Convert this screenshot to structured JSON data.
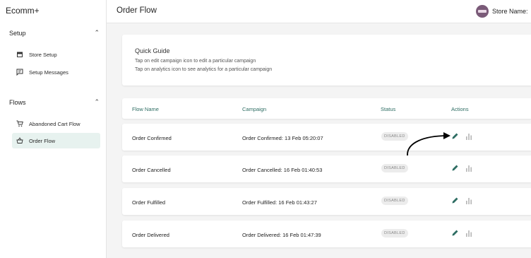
{
  "app": {
    "title": "Ecomm+"
  },
  "sidebar": {
    "sections": [
      {
        "title": "Setup",
        "items": [
          {
            "label": "Store Setup",
            "icon": "store-icon"
          },
          {
            "label": "Setup Messages",
            "icon": "message-icon"
          }
        ]
      },
      {
        "title": "Flows",
        "items": [
          {
            "label": "Abandoned Cart Flow",
            "icon": "cart-icon"
          },
          {
            "label": "Order Flow",
            "icon": "basket-icon",
            "active": true
          }
        ]
      }
    ]
  },
  "header": {
    "title": "Order Flow",
    "store_label": "Store Name:"
  },
  "guide": {
    "title": "Quick Guide",
    "lines": [
      "Tap on edit campaign icon to edit a particular campaign",
      "Tap on analytics icon to see analytics for a particular campaign"
    ]
  },
  "table": {
    "headers": [
      "Flow Name",
      "Campaign",
      "Status",
      "Actions"
    ],
    "rows": [
      {
        "flow": "Order Confirmed",
        "campaign": "Order Confirmed: 13 Feb 05:20:07",
        "status": "DISABLED"
      },
      {
        "flow": "Order Cancelled",
        "campaign": "Order Cancelled: 16 Feb 01:40:53",
        "status": "DISABLED"
      },
      {
        "flow": "Order Fulfilled",
        "campaign": "Order Fulfilled: 16 Feb 01:43:27",
        "status": "DISABLED"
      },
      {
        "flow": "Order Delivered",
        "campaign": "Order Delivered: 16 Feb 01:47:39",
        "status": "DISABLED"
      }
    ]
  },
  "colors": {
    "accent": "#2e6d63",
    "active_bg": "#e7f2ef",
    "badge_bg": "#ececec"
  }
}
